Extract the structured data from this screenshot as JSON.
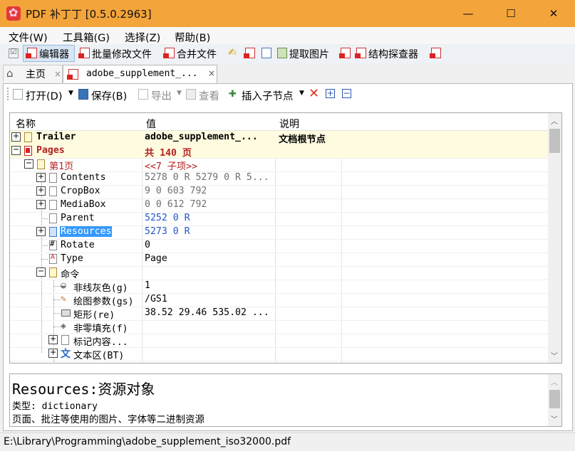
{
  "window": {
    "title": "PDF 补丁丁 [0.5.0.2963]",
    "minimize": "—",
    "maximize": "☐",
    "close": "✕"
  },
  "menu": [
    "文件(W)",
    "工具箱(G)",
    "选择(Z)",
    "帮助(B)"
  ],
  "toolbar": {
    "editor": "编辑器",
    "batch_modify": "批量修改文件",
    "merge": "合并文件",
    "extract_images": "提取图片",
    "struct_explorer": "结构探查器"
  },
  "tabs": {
    "home": "主页",
    "document": "adobe_supplement_...",
    "close_glyph": "×"
  },
  "doc_toolbar": {
    "open": "打开(D)",
    "save": "保存(B)",
    "export": "导出",
    "view": "查看",
    "insert_child": "插入子节点"
  },
  "grid": {
    "headers": [
      "名称",
      "值",
      "说明"
    ],
    "rows": [
      {
        "name": "Trailer",
        "value": "adobe_supplement_...",
        "desc": "文档根节点"
      },
      {
        "name": "Pages",
        "value": "共 140 页",
        "desc": ""
      },
      {
        "name": "第1页",
        "value": "<<7 子项>>",
        "desc": ""
      },
      {
        "name": "Contents",
        "value": "5278 0 R 5279 0 R 5...",
        "desc": ""
      },
      {
        "name": "CropBox",
        "value": "9 0 603 792",
        "desc": ""
      },
      {
        "name": "MediaBox",
        "value": "0 0 612 792",
        "desc": ""
      },
      {
        "name": "Parent",
        "value": "5252 0 R",
        "desc": ""
      },
      {
        "name": "Resources",
        "value": "5273 0 R",
        "desc": ""
      },
      {
        "name": "Rotate",
        "value": "0",
        "desc": ""
      },
      {
        "name": "Type",
        "value": "Page",
        "desc": ""
      },
      {
        "name": "命令",
        "value": "",
        "desc": ""
      },
      {
        "name": "非线灰色(g)",
        "value": "1",
        "desc": ""
      },
      {
        "name": "绘图参数(gs)",
        "value": "/GS1",
        "desc": ""
      },
      {
        "name": "矩形(re)",
        "value": "38.52 29.46 535.02 ...",
        "desc": ""
      },
      {
        "name": "非零填充(f)",
        "value": "",
        "desc": ""
      },
      {
        "name": "标记内容...",
        "value": "",
        "desc": ""
      },
      {
        "name": "文本区(BT)",
        "value": "",
        "desc": ""
      }
    ]
  },
  "description": {
    "title": "Resources:资源对象",
    "type_line": "类型: dictionary",
    "text": "页面、批注等使用的图片、字体等二进制资源"
  },
  "status": {
    "path": "E:\\Library\\Programming\\adobe_supplement_iso32000.pdf"
  },
  "colors": {
    "titlebar": "#f3a43a",
    "selection": "#3399ff",
    "header_row_bg": "#fffbe0"
  }
}
